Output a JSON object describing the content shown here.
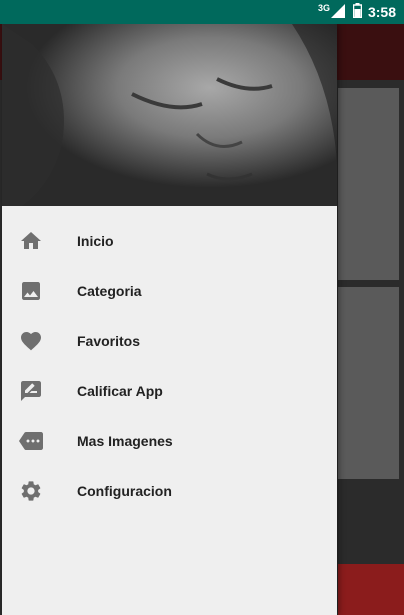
{
  "status_bar": {
    "network": "3G",
    "time": "3:58"
  },
  "drawer": {
    "menu": [
      {
        "label": "Inicio",
        "icon": "home-icon"
      },
      {
        "label": "Categoria",
        "icon": "image-icon"
      },
      {
        "label": "Favoritos",
        "icon": "heart-icon"
      },
      {
        "label": "Calificar App",
        "icon": "rate-review-icon"
      },
      {
        "label": "Mas Imagenes",
        "icon": "more-icon"
      },
      {
        "label": "Configuracion",
        "icon": "gear-icon"
      }
    ]
  },
  "colors": {
    "status_bar": "#00695c",
    "drawer_bg": "#efefef",
    "icon": "#6f6f6f",
    "toolbar_behind": "#3a0f10"
  }
}
